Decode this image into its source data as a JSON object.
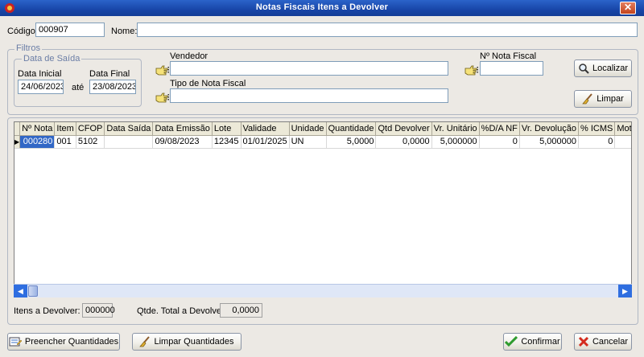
{
  "window": {
    "title": "Notas Fiscais Itens a Devolver",
    "close_glyph": "✕"
  },
  "header": {
    "codigo_label": "Código:",
    "codigo_value": "000907",
    "nome_label": "Nome:",
    "nome_value": ""
  },
  "filtros": {
    "legend": "Filtros",
    "datas": {
      "legend": "Data de Saída",
      "inicial_label": "Data Inicial",
      "inicial_value": "24/06/2023",
      "ate_label": "até",
      "final_label": "Data Final",
      "final_value": "23/08/2023"
    },
    "vendedor_label": "Vendedor",
    "vendedor_value": "",
    "tipo_label": "Tipo de Nota Fiscal",
    "tipo_value": "",
    "nota_label": "Nº Nota Fiscal",
    "nota_value": "",
    "localizar_label": "Localizar",
    "limpar_label": "Limpar"
  },
  "grid": {
    "columns": [
      "Nº Nota",
      "Item",
      "CFOP",
      "Data Saída",
      "Data Emissão",
      "Lote",
      "Validade",
      "Unidade",
      "Quantidade",
      "Qtd Devolver",
      "Vr. Unitário",
      "%D/A NF",
      "Vr. Devolução",
      "% ICMS",
      "Motivo"
    ],
    "rows": [
      [
        "000280",
        "001",
        "5102",
        "",
        "09/08/2023",
        "12345",
        "01/01/2025",
        "UN",
        "5,0000",
        "0,0000",
        "5,000000",
        "0",
        "5,000000",
        "0",
        ""
      ]
    ],
    "row_indicator": "▶"
  },
  "totals": {
    "itens_label": "Itens a Devolver:",
    "itens_value": "000000",
    "qtde_label": "Qtde. Total a Devolver:",
    "qtde_value": "0,0000"
  },
  "actions": {
    "preencher_label": "Preencher Quantidades",
    "limpar_label": "Limpar Quantidades",
    "confirmar_label": "Confirmar",
    "cancelar_label": "Cancelar"
  },
  "icons": {
    "app": "app-icon",
    "picker": "pointing-hand-icon",
    "localizar": "magnifier-icon",
    "limpar": "broom-icon",
    "preencher": "form-icon",
    "confirmar": "check-icon",
    "cancelar": "x-icon"
  },
  "colors": {
    "titlebar": "#1846a8",
    "selected_cell": "#3167c6",
    "confirm_check": "#2e9b2e",
    "cancel_x": "#d42b1e"
  }
}
